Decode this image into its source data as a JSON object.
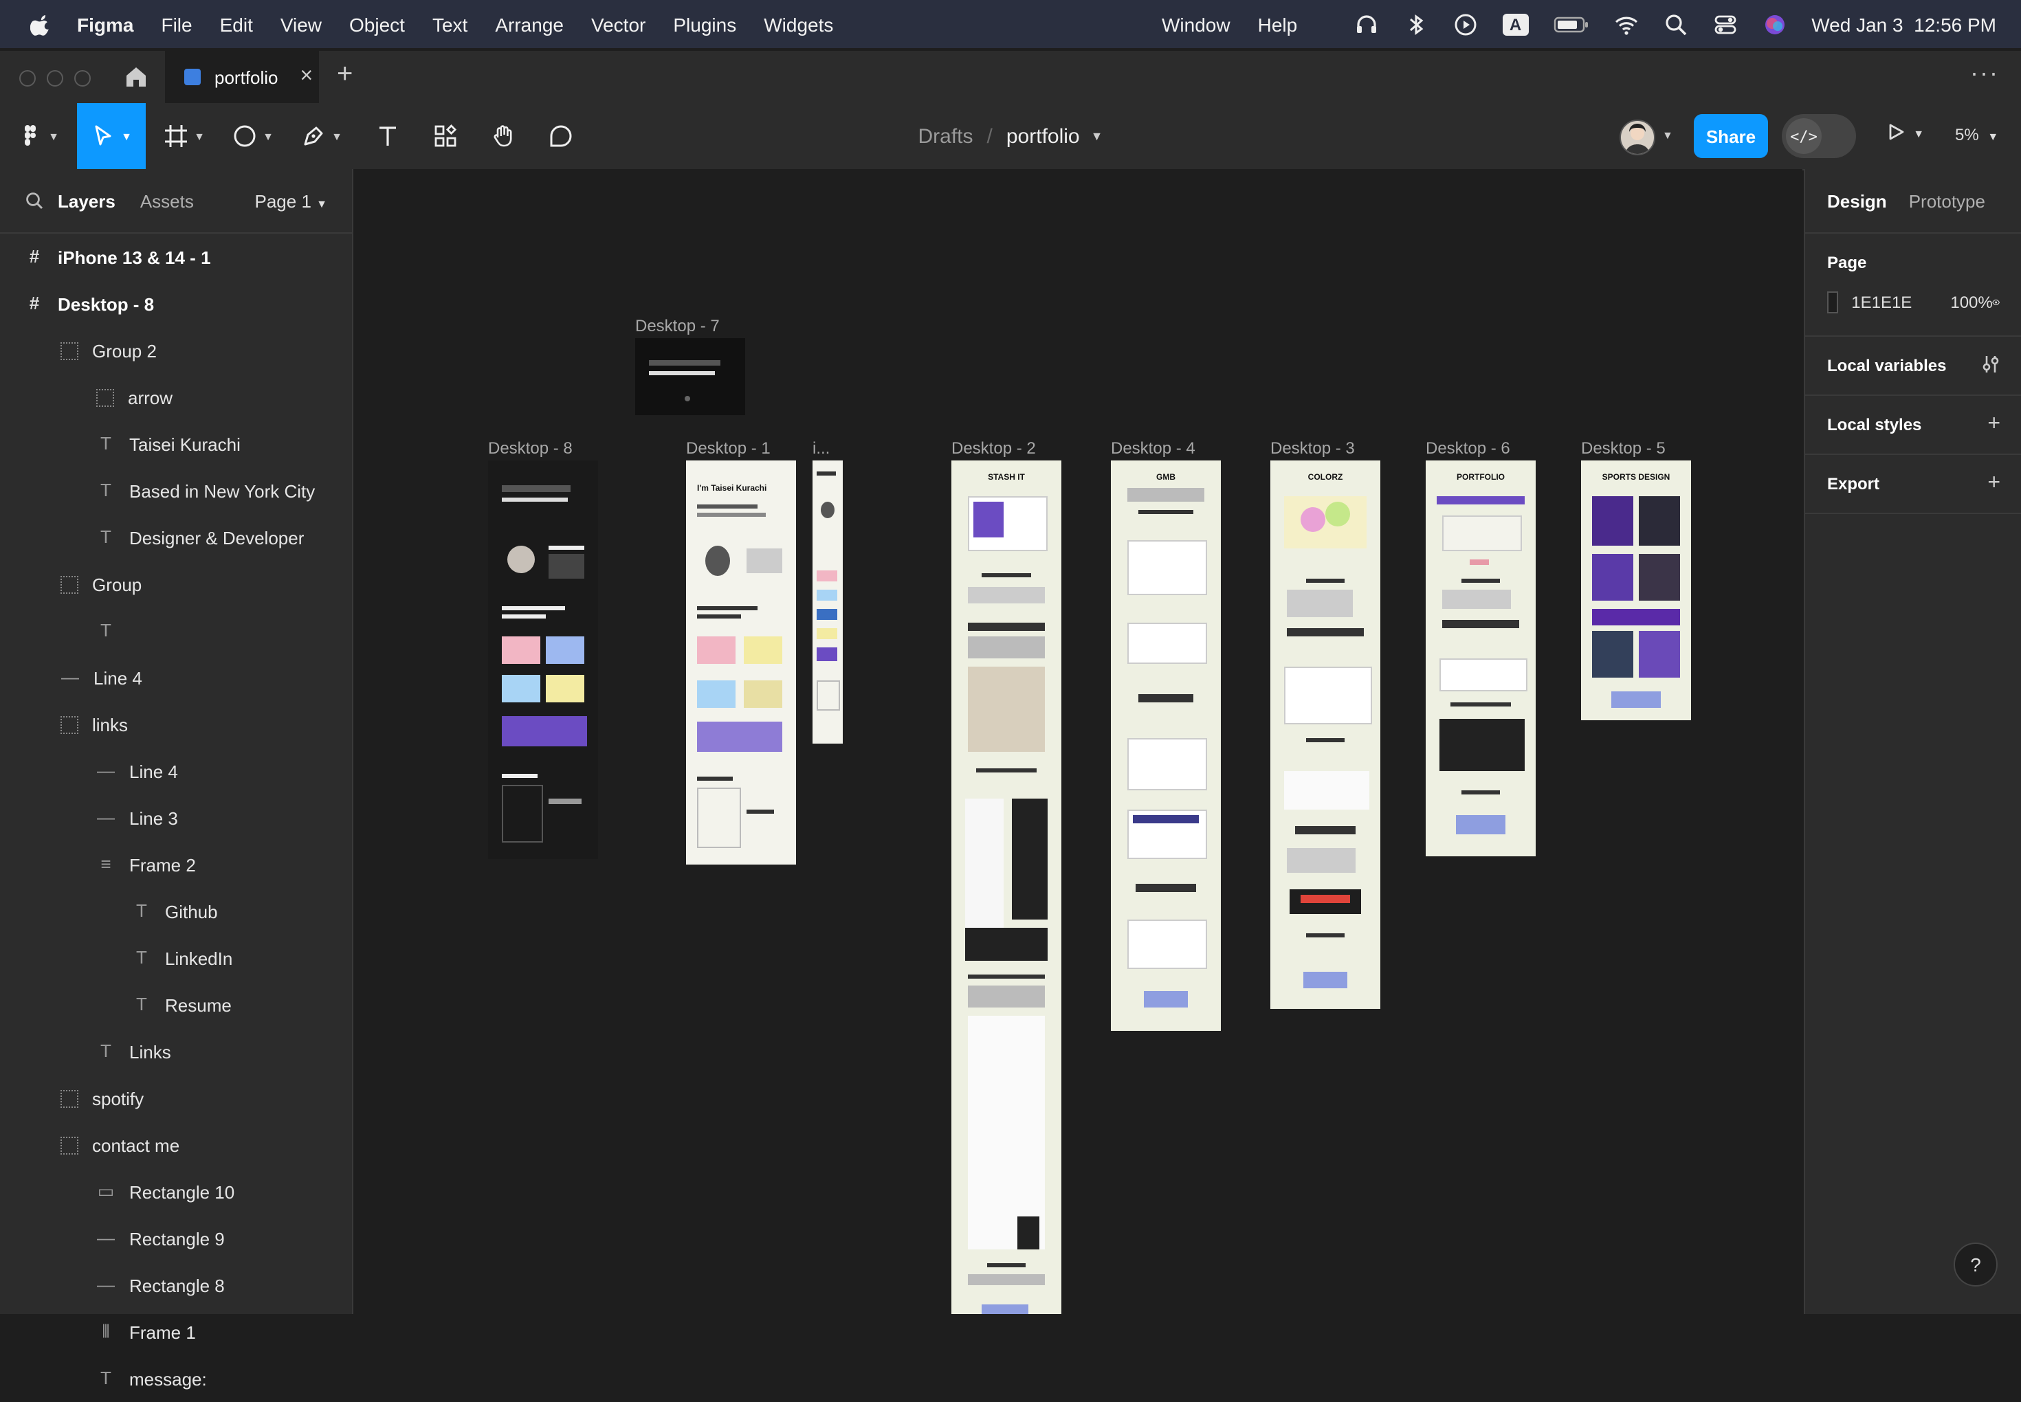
{
  "menubar": {
    "app_name": "Figma",
    "items": [
      "File",
      "Edit",
      "View",
      "Object",
      "Text",
      "Arrange",
      "Vector",
      "Plugins",
      "Widgets"
    ],
    "right_items": [
      "Window",
      "Help"
    ],
    "clock": "Wed Jan 3  12:56 PM",
    "input_source": "A"
  },
  "tabs": {
    "file_tab": "portfolio",
    "close_glyph": "×",
    "new_glyph": "+",
    "more_glyph": "···"
  },
  "toolbar": {
    "breadcrumb_drafts": "Drafts",
    "breadcrumb_sep": "/",
    "breadcrumb_file": "portfolio",
    "share_label": "Share",
    "dev_glyph": "</>",
    "zoom": "5%"
  },
  "left_panel": {
    "layers_tab": "Layers",
    "assets_tab": "Assets",
    "page_selector": "Page 1",
    "layers": [
      {
        "label": "iPhone 13 & 14 - 1",
        "icon": "#",
        "indent": 0,
        "bold": true
      },
      {
        "label": "Desktop - 8",
        "icon": "#",
        "indent": 0,
        "bold": true
      },
      {
        "label": "Group 2",
        "icon": "⋯",
        "indent": 1
      },
      {
        "label": "arrow",
        "icon": "⋯",
        "indent": 2
      },
      {
        "label": "Taisei Kurachi",
        "icon": "T",
        "indent": 2
      },
      {
        "label": "Based in New York City",
        "icon": "T",
        "indent": 2
      },
      {
        "label": "Designer & Developer",
        "icon": "T",
        "indent": 2
      },
      {
        "label": "Group",
        "icon": "⋯",
        "indent": 1
      },
      {
        "label": "",
        "icon": "T",
        "indent": 2
      },
      {
        "label": "Line 4",
        "icon": "—",
        "indent": 1
      },
      {
        "label": "links",
        "icon": "⋯",
        "indent": 1
      },
      {
        "label": "Line 4",
        "icon": "—",
        "indent": 2
      },
      {
        "label": "Line 3",
        "icon": "—",
        "indent": 2
      },
      {
        "label": "Frame 2",
        "icon": "≡",
        "indent": 2
      },
      {
        "label": "Github",
        "icon": "T",
        "indent": 3
      },
      {
        "label": "LinkedIn",
        "icon": "T",
        "indent": 3
      },
      {
        "label": "Resume",
        "icon": "T",
        "indent": 3
      },
      {
        "label": "Links",
        "icon": "T",
        "indent": 2
      },
      {
        "label": "spotify",
        "icon": "⋯",
        "indent": 1
      },
      {
        "label": "contact me",
        "icon": "⋯",
        "indent": 1
      },
      {
        "label": "Rectangle 10",
        "icon": "▭",
        "indent": 2
      },
      {
        "label": "Rectangle 9",
        "icon": "—",
        "indent": 2
      },
      {
        "label": "Rectangle 8",
        "icon": "—",
        "indent": 2
      },
      {
        "label": "Frame 1",
        "icon": "⫴",
        "indent": 2
      },
      {
        "label": "message:",
        "icon": "T",
        "indent": 2
      }
    ]
  },
  "canvas": {
    "frames": [
      {
        "label": "Desktop - 7",
        "title": "",
        "dark": true
      },
      {
        "label": "Desktop - 8",
        "title": "",
        "dark": true
      },
      {
        "label": "Desktop - 1",
        "title": "I'm Taisei Kurachi"
      },
      {
        "label": "i...",
        "title": ""
      },
      {
        "label": "Desktop - 2",
        "title": "STASH IT"
      },
      {
        "label": "Desktop - 4",
        "title": "GMB"
      },
      {
        "label": "Desktop - 3",
        "title": "COLORZ"
      },
      {
        "label": "Desktop - 6",
        "title": "PORTFOLIO"
      },
      {
        "label": "Desktop - 5",
        "title": "SPORTS DESIGN"
      }
    ]
  },
  "right_panel": {
    "design_tab": "Design",
    "prototype_tab": "Prototype",
    "page_header": "Page",
    "page_color": "1E1E1E",
    "page_opacity": "100%",
    "local_variables": "Local variables",
    "local_styles": "Local styles",
    "export": "Export",
    "plus_glyph": "+",
    "help_glyph": "?"
  },
  "colors": {
    "accent": "#0d99ff",
    "canvas": "#1e1e1e",
    "panel": "#2c2c2c",
    "frame_bg": "#eef0e2"
  }
}
